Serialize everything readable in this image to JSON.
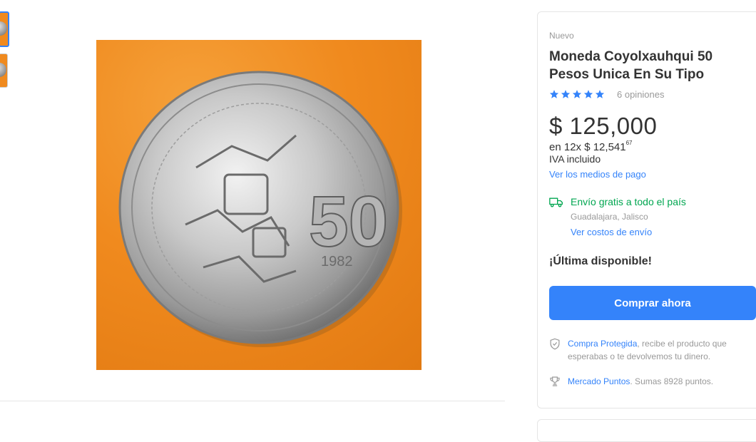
{
  "gallery": {
    "thumbnails": [
      "coin-thumb-front",
      "coin-thumb-back"
    ],
    "main_image": "coin-photo"
  },
  "product": {
    "condition": "Nuevo",
    "title": "Moneda Coyolxauhqui 50 Pesos Unica En Su Tipo",
    "rating": 5,
    "reviews": "6 opiniones",
    "price": "$ 125,000",
    "installments_prefix": "en 12x $ 12,541",
    "installments_cents": "67",
    "tax": "IVA incluido",
    "payment_link": "Ver los medios de pago",
    "shipping": "Envío gratis a todo el país",
    "location": "Guadalajara, Jalisco",
    "shipping_cost_link": "Ver costos de envío",
    "stock": "¡Última disponible!",
    "buy_button": "Comprar ahora",
    "protection_link": "Compra Protegida",
    "protection_text": ", recibe el producto que esperabas o te devolvemos tu dinero.",
    "points_link": "Mercado Puntos",
    "points_text": ". Sumas 8928 puntos."
  },
  "colors": {
    "accent": "#3483fa",
    "success": "#00a650",
    "image_background": "#f08a1e"
  },
  "icons": [
    "star-icon",
    "truck-icon",
    "shield-icon",
    "trophy-icon"
  ]
}
